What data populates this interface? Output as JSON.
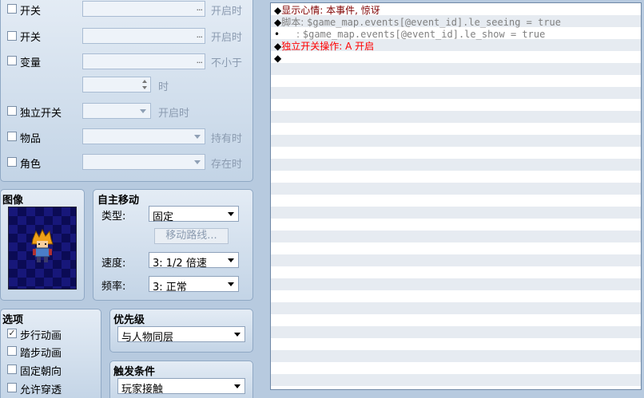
{
  "conditions": {
    "switch1": {
      "label": "开关",
      "suffix": "开启时"
    },
    "switch2": {
      "label": "开关",
      "suffix": "开启时"
    },
    "variable": {
      "label": "变量",
      "suffix": "不小于",
      "spin_suffix": "时"
    },
    "self_switch": {
      "label": "独立开关",
      "suffix": "开启时"
    },
    "item": {
      "label": "物品",
      "suffix": "持有时"
    },
    "actor": {
      "label": "角色",
      "suffix": "存在时"
    },
    "ellipsis": "..."
  },
  "image": {
    "title": "图像"
  },
  "autonomous": {
    "title": "自主移动",
    "type_label": "类型:",
    "type_value": "固定",
    "route_button": "移动路线...",
    "speed_label": "速度:",
    "speed_value": "3: 1/2 倍速",
    "freq_label": "频率:",
    "freq_value": "3: 正常"
  },
  "options": {
    "title": "选项",
    "items": [
      {
        "label": "步行动画",
        "checked": true,
        "mark": "✓"
      },
      {
        "label": "踏步动画",
        "checked": false
      },
      {
        "label": "固定朝向",
        "checked": false
      },
      {
        "label": "允许穿透",
        "checked": false
      }
    ]
  },
  "priority": {
    "title": "优先级",
    "value": "与人物同层"
  },
  "trigger": {
    "title": "触发条件",
    "value": "玩家接触"
  },
  "commands": [
    {
      "bullet": "◆",
      "prefix": "显示心情:",
      "text": "本事件, 惊讶",
      "color": "#800000"
    },
    {
      "bullet": "◆",
      "prefix": "脚本:",
      "text": "$game_map.events[@event_id].le_seeing = true",
      "color": "#808080"
    },
    {
      "bullet": "•",
      "prefix": ":",
      "text": "$game_map.events[@event_id].le_show = true",
      "color": "#808080"
    },
    {
      "bullet": "◆",
      "prefix": "独立开关操作:",
      "text": "A 开启",
      "color": "#ff0000"
    },
    {
      "bullet": "◆",
      "prefix": "",
      "text": "",
      "color": "#000000"
    }
  ]
}
